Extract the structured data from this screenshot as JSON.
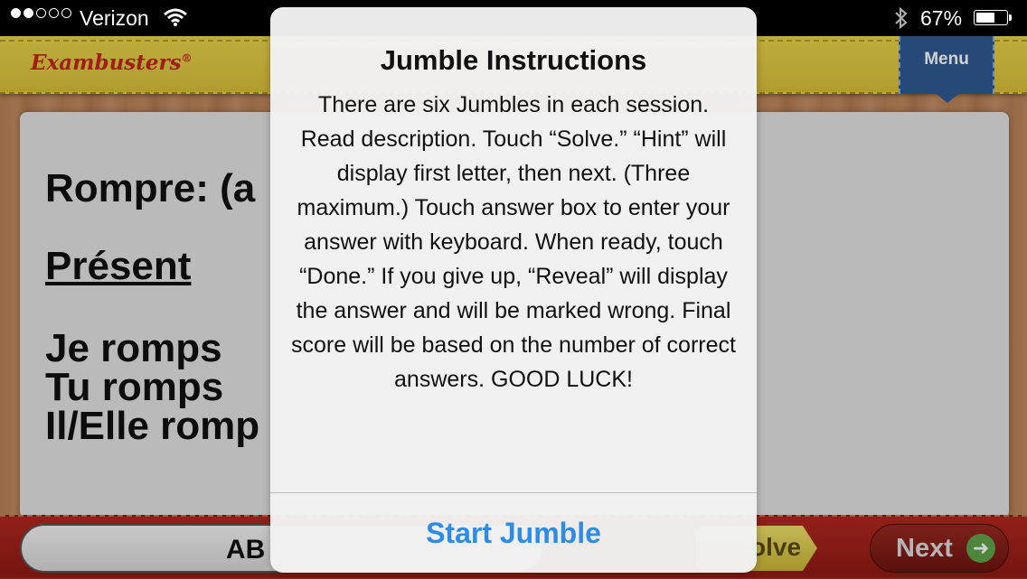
{
  "status_bar": {
    "carrier": "Verizon",
    "signal_bars": 2,
    "signal_total": 5,
    "battery_percent": "67%",
    "battery_level": 0.67,
    "wifi_icon": "wifi-icon",
    "bluetooth_icon": "bluetooth-icon"
  },
  "header": {
    "logo": "Exambusters",
    "logo_mark": "®",
    "menu_label": "Menu",
    "header_color": "#e2cc44",
    "menu_color": "#2f5a93"
  },
  "card": {
    "verb_title": "Rompre: (a",
    "tense": "Présent",
    "conjugations": [
      "Je romps",
      "Tu romps",
      "Il/Elle romp"
    ]
  },
  "bottom_bar": {
    "answer_text": "AB",
    "solve_label": "olve",
    "next_label": "Next",
    "next_icon": "arrow-right-icon",
    "bar_color": "#a4221a"
  },
  "alert": {
    "title": "Jumble Instructions",
    "message": "There are six Jumbles in each session. Read description. Touch “Solve.” “Hint” will display first letter, then next. (Three maximum.) Touch answer box to enter your answer with keyboard. When ready, touch “Done.” If you give up, “Reveal” will display the answer and will be marked wrong. Final score will be based on the number of correct answers. GOOD LUCK!",
    "button_label": "Start Jumble",
    "button_color": "#2e8be6"
  }
}
